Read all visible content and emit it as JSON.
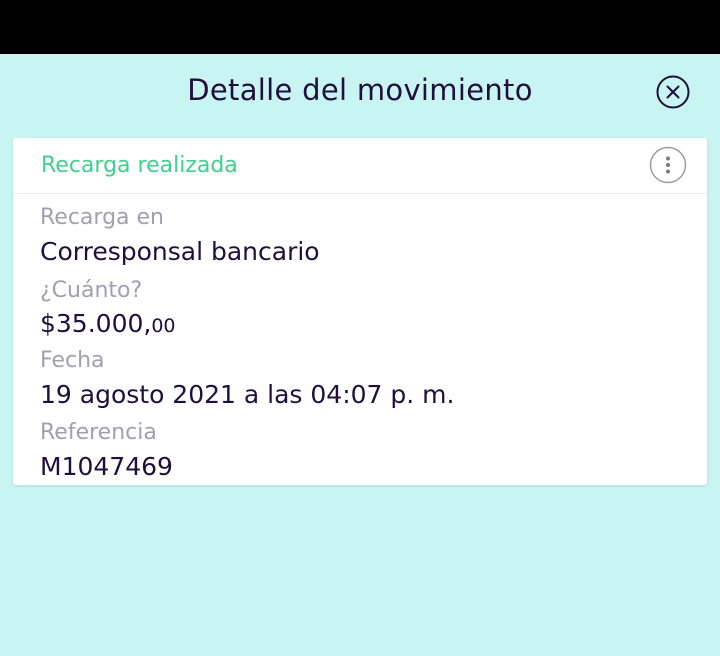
{
  "header": {
    "title": "Detalle del movimiento",
    "close_icon": "close-circle-icon"
  },
  "card": {
    "status": "Recarga realizada",
    "more_icon": "more-vertical-icon",
    "fields": [
      {
        "label": "Recarga en",
        "value": "Corresponsal bancario"
      },
      {
        "label": "¿Cuánto?",
        "value_main": "$35.000,",
        "value_cents": "00"
      },
      {
        "label": "Fecha",
        "value": "19 agosto 2021 a las 04:07 p. m."
      },
      {
        "label": "Referencia",
        "value": "M1047469"
      }
    ]
  },
  "colors": {
    "background": "#c8f5f1",
    "text_primary": "#200e3c",
    "text_secondary": "#a2a0ad",
    "accent_green": "#3fd08e",
    "card": "#ffffff"
  }
}
